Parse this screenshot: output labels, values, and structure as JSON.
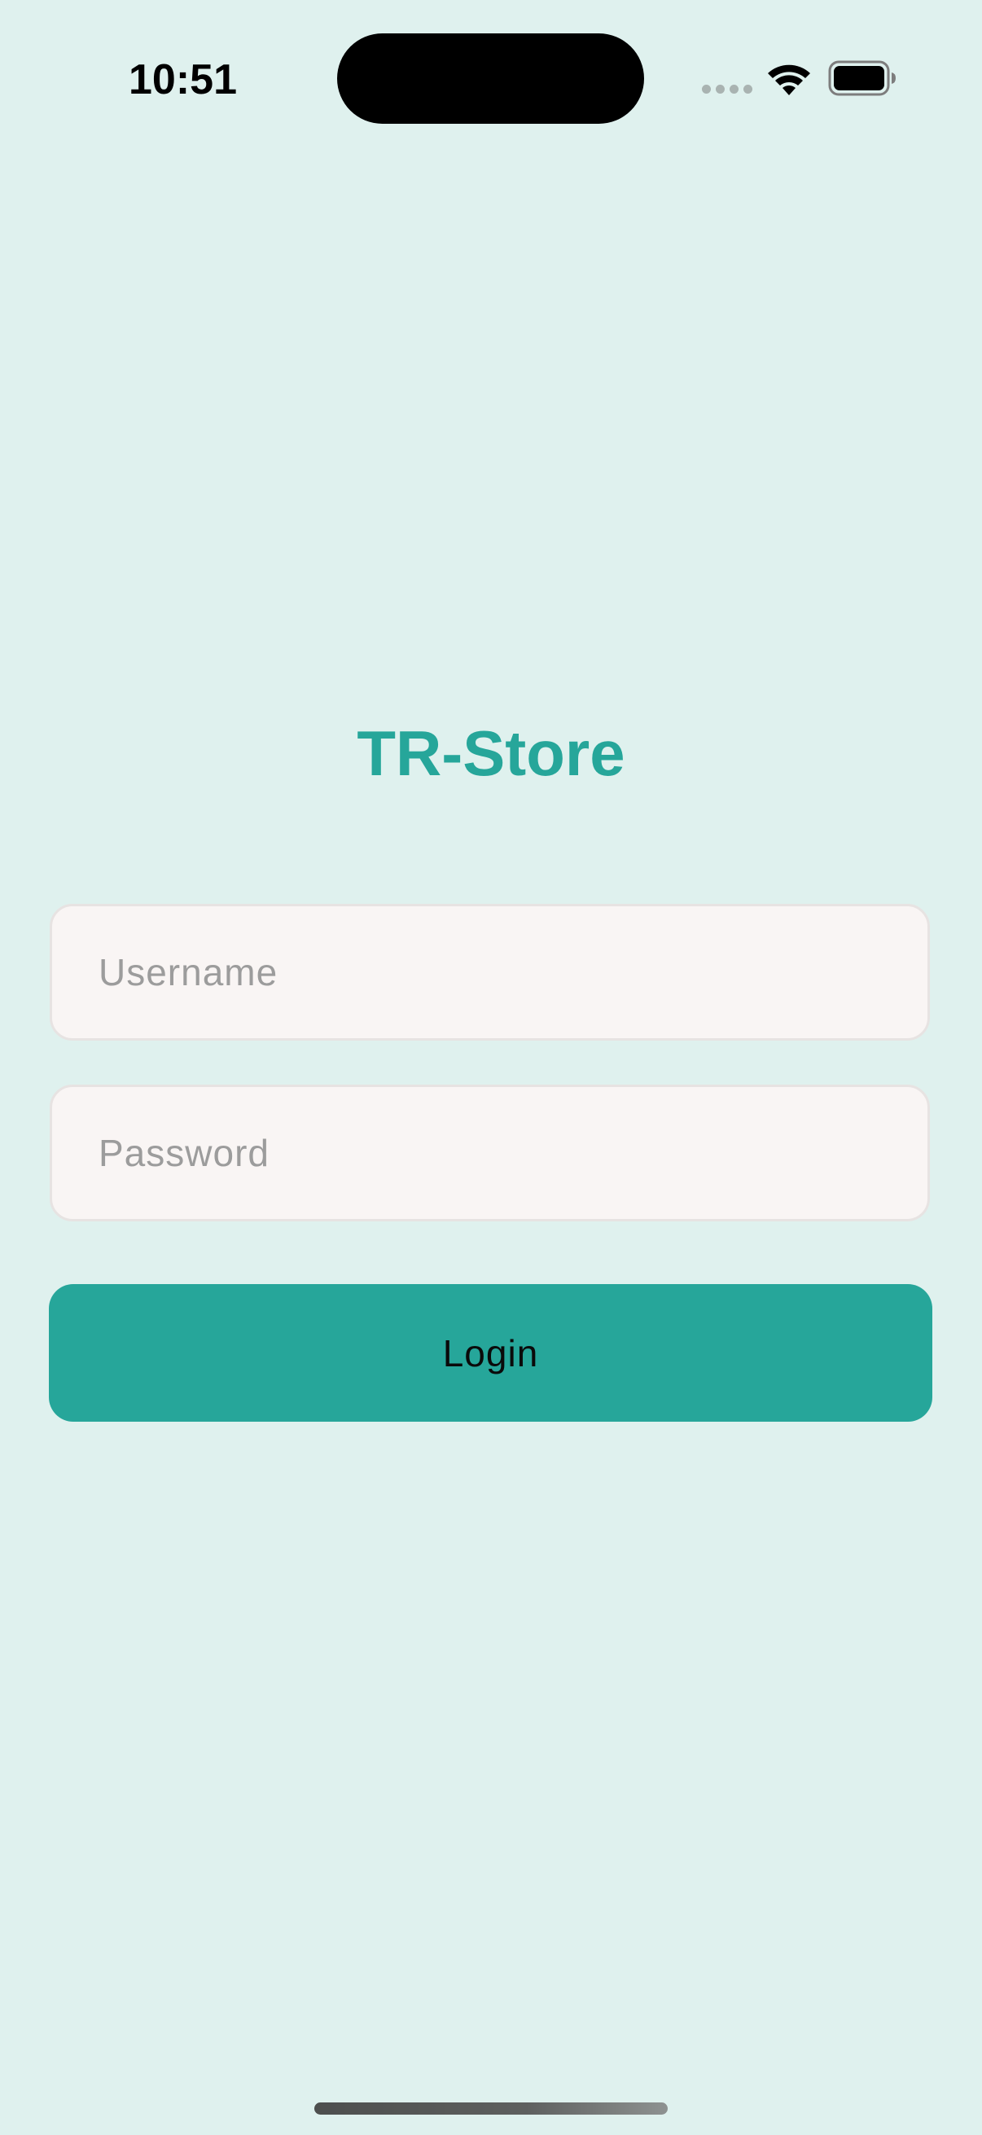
{
  "status_bar": {
    "time": "10:51",
    "icons": [
      "cellular-signal-icon",
      "wifi-icon",
      "battery-icon"
    ]
  },
  "app": {
    "title": "TR-Store"
  },
  "form": {
    "username": {
      "placeholder": "Username",
      "value": ""
    },
    "password": {
      "placeholder": "Password",
      "value": ""
    },
    "login_label": "Login"
  },
  "colors": {
    "background": "#dff1ee",
    "accent": "#26a69a",
    "field_background": "#f9f5f4",
    "field_border": "#e7e3e2",
    "placeholder_text": "#9c9c9c"
  }
}
